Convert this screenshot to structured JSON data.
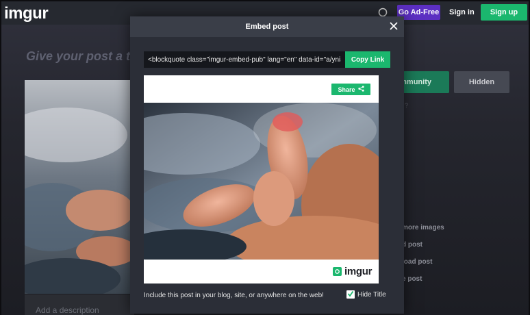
{
  "header": {
    "logo": "imgur",
    "ad_free_label": "Go Ad-Free",
    "sign_in_label": "Sign in",
    "sign_up_label": "Sign up"
  },
  "background": {
    "title_prompt": "Give your post a ti",
    "add_description": "Add a description",
    "community_label": "mmunity",
    "hidden_label": "Hidden",
    "menu": [
      "more images",
      "d post",
      "load post",
      "e post"
    ]
  },
  "modal": {
    "title": "Embed post",
    "embed_code": "<blockquote class=\"imgur-embed-pub\" lang=\"en\" data-id=\"a/yniS",
    "copy_label": "Copy Link",
    "share_label": "Share",
    "brand": "imgur",
    "footer_text": "Include this post in your blog, site, or anywhere on the web!",
    "hide_title_label": "Hide Title",
    "hide_title_checked": true
  },
  "colors": {
    "accent_green": "#1bb76e",
    "ad_free_purple": "#5c2fc2",
    "modal_bg": "#2b2e37"
  },
  "icons": {
    "search": "search-icon",
    "close": "close-icon",
    "share": "share-icon",
    "check": "check-icon",
    "brand": "imgur-logo-icon"
  }
}
